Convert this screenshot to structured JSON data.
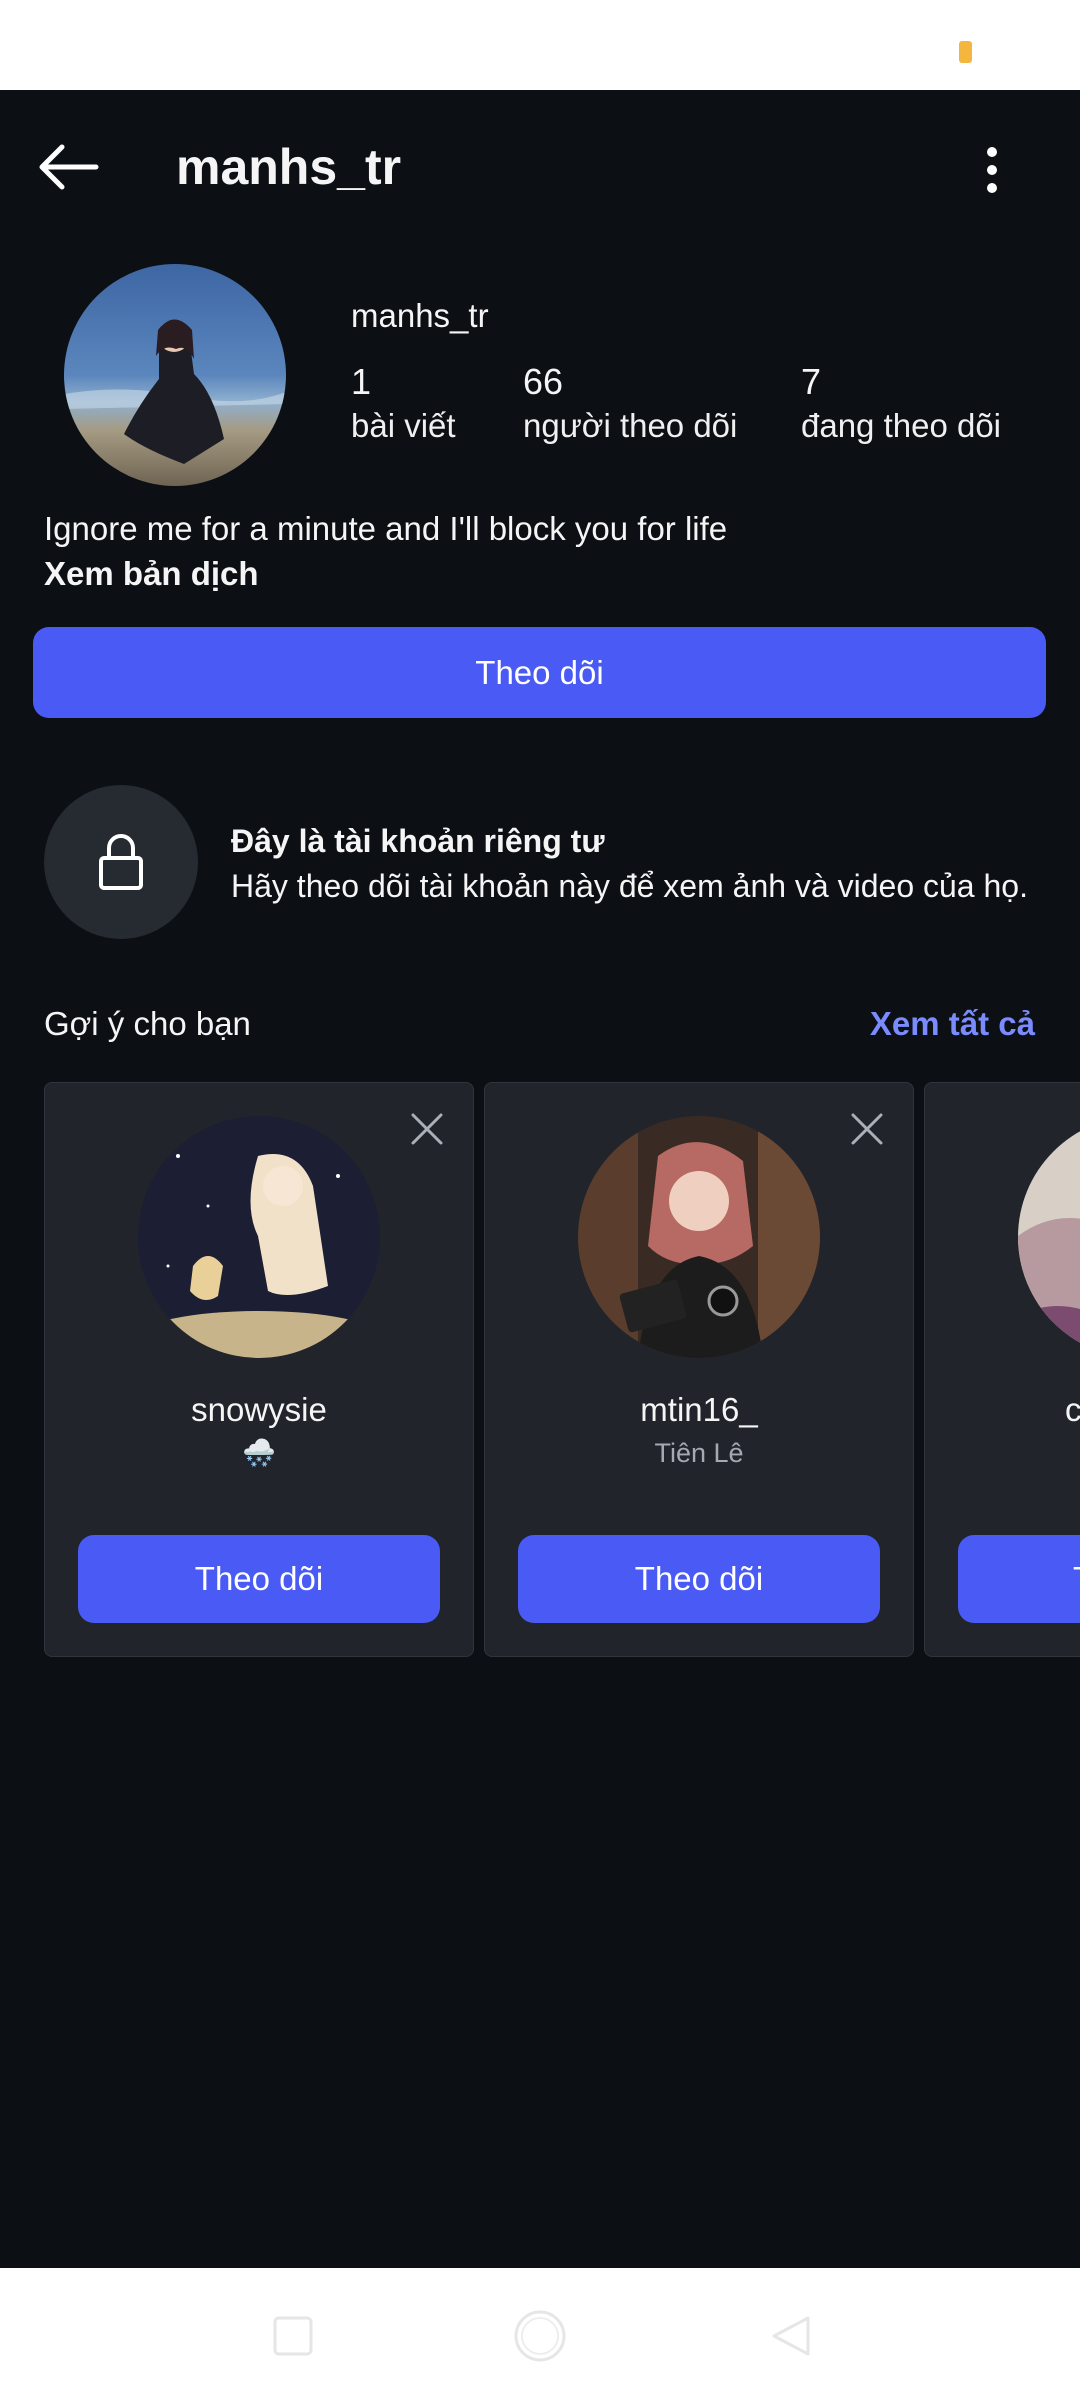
{
  "header": {
    "title": "manhs_tr"
  },
  "profile": {
    "username": "manhs_tr",
    "stats": [
      {
        "value": "1",
        "label": "bài viết"
      },
      {
        "value": "66",
        "label": "người theo dõi"
      },
      {
        "value": "7",
        "label": "đang theo dõi"
      }
    ],
    "bio": "Ignore me for a minute and I'll block you for life",
    "translate_label": "Xem bản dịch",
    "follow_label": "Theo dõi"
  },
  "private": {
    "title": "Đây là tài khoản riêng tư",
    "subtitle": "Hãy theo dõi tài khoản này để xem ảnh và video của họ."
  },
  "suggestions": {
    "title": "Gợi ý cho bạn",
    "see_all": "Xem tất cả",
    "cards": [
      {
        "name": "snowysie",
        "sub": "🌨️",
        "button": "Theo dõi"
      },
      {
        "name": "mtin16_",
        "sub": "Tiên Lê",
        "button": "Theo dõi"
      },
      {
        "name": "c",
        "sub": "",
        "button": "T"
      }
    ]
  },
  "icons": {
    "back": "arrow-left-icon",
    "more": "more-vertical-icon",
    "lock": "lock-icon",
    "close": "close-icon",
    "nav_recent": "square-icon",
    "nav_home": "circle-icon",
    "nav_back": "triangle-back-icon"
  },
  "colors": {
    "background": "#0c0f14",
    "accent": "#4a5bf5",
    "link": "#7a8bff",
    "card": "#21242b"
  }
}
